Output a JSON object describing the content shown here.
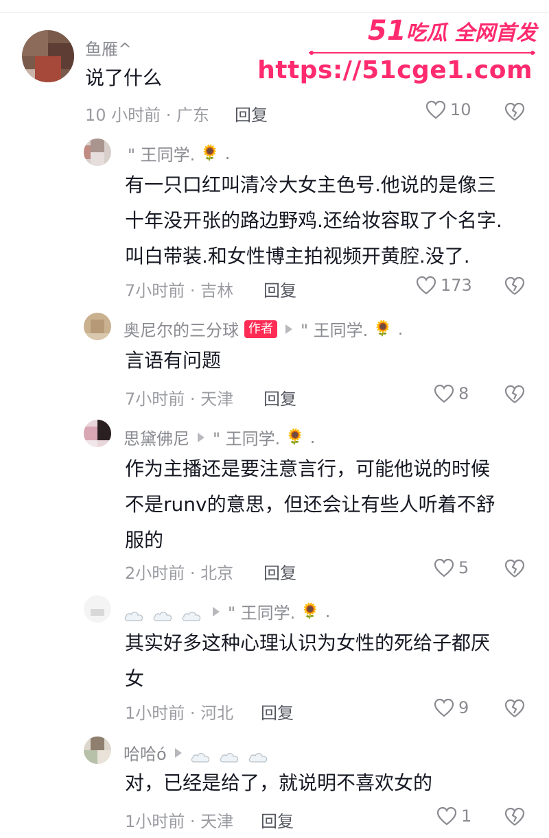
{
  "watermark": {
    "brand_number": "51",
    "brand_text": "吃瓜 全网首发",
    "url": "https://51cge1.com"
  },
  "comments": [
    {
      "username": "鱼雁^",
      "text": "说了什么",
      "time_location": "10 小时前 · 广东",
      "reply_label": "回复",
      "likes": "10"
    },
    {
      "username": "\" 王同学.",
      "username_suffix": ".",
      "text_lines": [
        "有一只口红叫清冷大女主色号.他说的是像三",
        "十年没开张的路边野鸡.还给妆容取了个名字.",
        "叫白带装.和女性博主拍视频开黄腔.没了."
      ],
      "time_location": "7小时前 · 吉林",
      "reply_label": "回复",
      "likes": "173"
    },
    {
      "username": "奥尼尔的三分球",
      "badge": "作者",
      "reply_to": "\" 王同学.",
      "reply_to_suffix": ".",
      "text": "言语有问题",
      "time_location": "7小时前 · 天津",
      "reply_label": "回复",
      "likes": "8"
    },
    {
      "username": "思黛佛尼",
      "reply_to": "\" 王同学.",
      "reply_to_suffix": ".",
      "text_lines": [
        "作为主播还是要注意言行，可能他说的时候",
        "不是runv的意思，但还会让有些人听着不舒",
        "服的"
      ],
      "time_location": "2小时前 · 北京",
      "reply_label": "回复",
      "likes": "5"
    },
    {
      "reply_to": "\" 王同学.",
      "reply_to_suffix": ".",
      "text_lines": [
        "其实好多这种心理认识为女性的死给子都厌",
        "女"
      ],
      "time_location": "1小时前 · 河北",
      "reply_label": "回复",
      "likes": "9"
    },
    {
      "username": "哈哈ó",
      "text": "对，已经是给了，就说明不喜欢女的",
      "time_location": "1小时前 · 天津",
      "reply_label": "回复",
      "likes": "1"
    }
  ],
  "icons": {
    "like": "heart-outline-icon",
    "dislike": "broken-heart-icon",
    "sunflower": "🌻",
    "arrow": "triangle-right-icon",
    "cloud": "cloud-icon"
  },
  "colors": {
    "badge": "#fe2c55",
    "watermark": "#ff2b6e",
    "meta": "#9b9ca2",
    "text": "#161823"
  }
}
